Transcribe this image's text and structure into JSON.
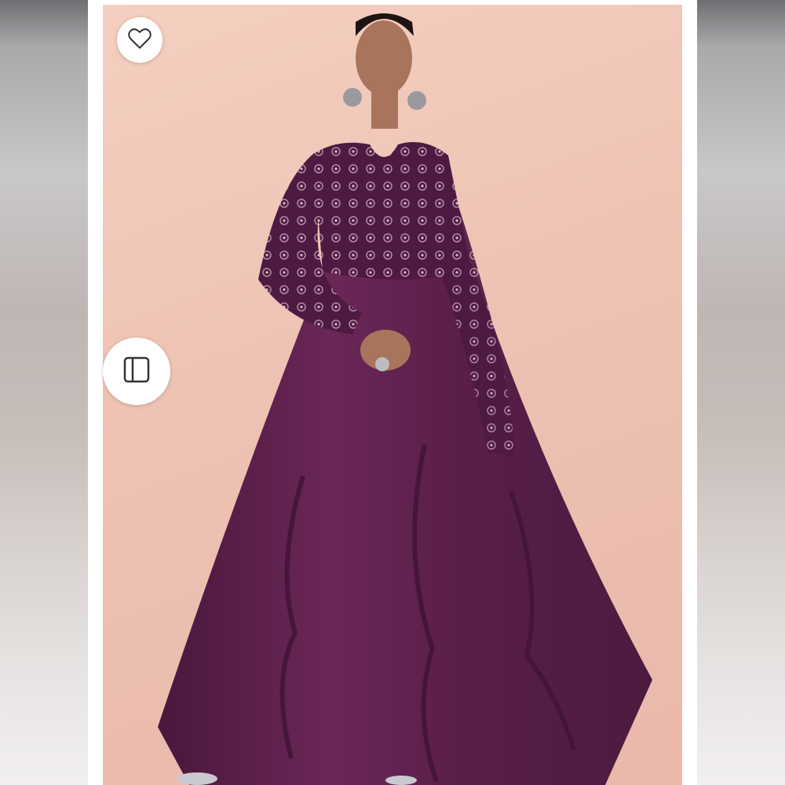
{
  "viewer": {
    "controls": {
      "like_icon": "heart-outline-icon",
      "panel_icon": "sidebar-panel-icon"
    },
    "colors": {
      "background_peach": "#eec2b3",
      "dress_plum": "#5a1f49",
      "button_bg": "#ffffff",
      "icon_stroke": "#333333"
    }
  }
}
